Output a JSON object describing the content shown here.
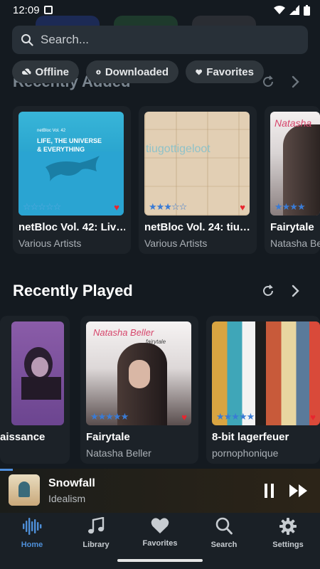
{
  "status_bar": {
    "time": "12:09"
  },
  "search": {
    "placeholder": "Search..."
  },
  "chips": [
    {
      "label": "Offline",
      "icon": "cloud-off-icon"
    },
    {
      "label": "Downloaded",
      "icon": "download-circle-icon"
    },
    {
      "label": "Favorites",
      "icon": "heart-icon"
    }
  ],
  "recently_added": {
    "title": "Recently Added",
    "cards": [
      {
        "title": "netBloc Vol. 42: Liv…",
        "artist": "Various Artists",
        "rating": 0,
        "favorite": true,
        "art_text_1": "LIFE, THE UNIVERSE",
        "art_text_2": "& EVERYTHING",
        "art_small": "netBloc Vol. 42"
      },
      {
        "title": "netBloc Vol. 24: tiu…",
        "artist": "Various Artists",
        "rating": 3,
        "favorite": true,
        "art_text_1": "tiugottigeloot"
      },
      {
        "title": "Fairytale",
        "artist": "Natasha Beller",
        "rating": 5,
        "favorite": false,
        "art_text_1": "Natasha"
      }
    ]
  },
  "recently_played": {
    "title": "Recently Played",
    "cards": [
      {
        "title": "aissance",
        "artist": "",
        "rating": 0,
        "favorite": false
      },
      {
        "title": "Fairytale",
        "artist": "Natasha Beller",
        "rating": 5,
        "favorite": true,
        "art_text_1": "Natasha Beller",
        "art_text_2": "fairytale"
      },
      {
        "title": "8-bit lagerfeuer",
        "artist": "pornophonique",
        "rating": 5,
        "favorite": true
      }
    ]
  },
  "player": {
    "title": "Snowfall",
    "artist": "Idealism"
  },
  "nav": [
    {
      "label": "Home",
      "icon": "waveform-icon",
      "active": true
    },
    {
      "label": "Library",
      "icon": "music-note-icon",
      "active": false
    },
    {
      "label": "Favorites",
      "icon": "heart-icon",
      "active": false
    },
    {
      "label": "Search",
      "icon": "search-icon",
      "active": false
    },
    {
      "label": "Settings",
      "icon": "gear-icon",
      "active": false
    }
  ],
  "colors": {
    "accent": "#4e8fd8",
    "heart": "#e8262f",
    "star": "#3a7bd5"
  }
}
